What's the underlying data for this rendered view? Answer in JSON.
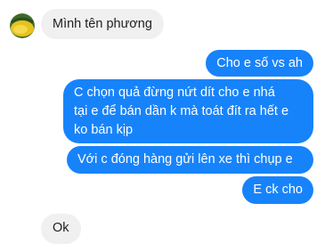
{
  "conversation": {
    "messages": [
      {
        "side": "incoming",
        "text": "Mình tên phương"
      },
      {
        "side": "outgoing",
        "text": "Cho e số vs ah"
      },
      {
        "side": "outgoing",
        "lines": [
          "C chọn quả đừng nứt dít cho e nhá",
          "tại e để bán dần k mà toát đít ra hết e",
          "ko bán kịp"
        ]
      },
      {
        "side": "outgoing",
        "text": "Với c đóng hàng gửi lên xe thì chụp e"
      },
      {
        "side": "outgoing",
        "text": "E ck cho"
      },
      {
        "side": "incoming",
        "text": "Ok"
      }
    ]
  },
  "colors": {
    "outgoing_bubble": "#1783fb",
    "incoming_bubble": "#f0f0f0",
    "outgoing_text": "#ffffff",
    "incoming_text": "#1c1e21"
  },
  "icons": {
    "contact_avatar": "avatar-icon"
  }
}
